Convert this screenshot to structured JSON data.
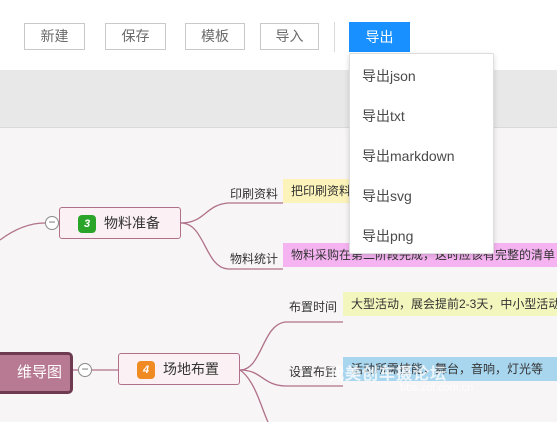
{
  "toolbar": {
    "new_label": "新建",
    "save_label": "保存",
    "template_label": "模板",
    "import_label": "导入",
    "export_label": "导出",
    "accent": "#1890ff"
  },
  "export_menu": {
    "items": [
      "导出json",
      "导出txt",
      "导出markdown",
      "导出svg",
      "导出png"
    ]
  },
  "mindmap": {
    "root": {
      "label": "维导图"
    },
    "branches": [
      {
        "num": "3",
        "label": "物料准备",
        "badge_color": "#2aa52a",
        "subs": [
          {
            "label": "印刷资料",
            "note": "把印刷资料",
            "note_color": "#fbf3b9"
          },
          {
            "label": "物料统计",
            "note": "物料采购在第二阶段完成，这时应该有完整的清单",
            "note_color": "#f6b3f2"
          }
        ]
      },
      {
        "num": "4",
        "label": "场地布置",
        "badge_color": "#f08a23",
        "subs": [
          {
            "label": "布置时间",
            "note": "大型活动，展会提前2-3天，中小型活动",
            "note_color": "#f4f7bd"
          },
          {
            "label": "设置布置",
            "note": "活动所需技能，舞台，音响，灯光等",
            "note_color": "#a9d6ef"
          }
        ]
      }
    ]
  },
  "watermark": {
    "text": "我美创车摄论坛",
    "url": "bbs.zol.com.cn"
  }
}
